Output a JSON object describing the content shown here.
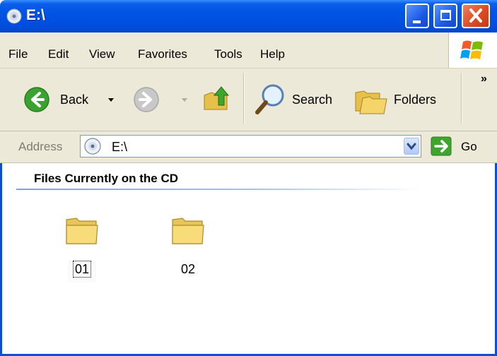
{
  "window": {
    "title": "E:\\",
    "min_icon": "minimize-icon",
    "max_icon": "maximize-icon",
    "close_icon": "close-icon"
  },
  "menu": {
    "items": [
      "File",
      "Edit",
      "View",
      "Favorites",
      "Tools",
      "Help"
    ]
  },
  "toolbar": {
    "back_label": "Back",
    "search_label": "Search",
    "folders_label": "Folders",
    "more_label": "»"
  },
  "address": {
    "label": "Address",
    "value": "E:\\",
    "go_label": "Go"
  },
  "content": {
    "group_title": "Files Currently on the CD",
    "folders": [
      {
        "name": "01",
        "selected": true
      },
      {
        "name": "02",
        "selected": false
      }
    ]
  },
  "colors": {
    "titlebar": "#0054e3",
    "chrome": "#ece9d8",
    "close_button": "#dd4b22",
    "go_arrow": "#3fa52c"
  }
}
